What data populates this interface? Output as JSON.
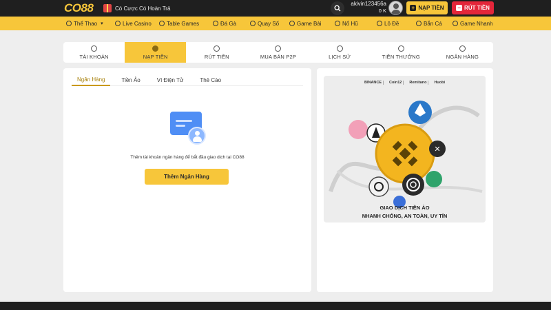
{
  "header": {
    "logo": "CO88",
    "promo_text": "Có Cược Có Hoàn Trả",
    "username": "akivin123456a",
    "balance": "0 K",
    "deposit_label": "NẠP TIỀN",
    "withdraw_label": "RÚT TIỀN"
  },
  "nav": {
    "items": [
      {
        "label": "Thể Thao",
        "icon": "sports-icon"
      },
      {
        "label": "Live Casino",
        "icon": "casino-icon"
      },
      {
        "label": "Table Games",
        "icon": "table-games-icon"
      },
      {
        "label": "Đá Gà",
        "icon": "cockfight-icon"
      },
      {
        "label": "Quay Số",
        "icon": "lottery-wheel-icon"
      },
      {
        "label": "Game Bài",
        "icon": "cards-icon"
      },
      {
        "label": "Nổ Hũ",
        "icon": "slots-icon"
      },
      {
        "label": "Lô Đề",
        "icon": "lotto-icon"
      },
      {
        "label": "Bắn Cá",
        "icon": "fishing-icon"
      },
      {
        "label": "Game Nhanh",
        "icon": "quick-game-icon"
      }
    ]
  },
  "account_tabs": {
    "items": [
      {
        "label": "TÀI KHOẢN",
        "icon": "account-icon"
      },
      {
        "label": "NẠP TIỀN",
        "icon": "deposit-icon"
      },
      {
        "label": "RÚT TIỀN",
        "icon": "withdraw-icon"
      },
      {
        "label": "MUA BÁN P2P",
        "icon": "p2p-icon"
      },
      {
        "label": "LỊCH SỬ",
        "icon": "history-icon"
      },
      {
        "label": "TIỀN THƯỞNG",
        "icon": "bonus-icon"
      },
      {
        "label": "NGÂN HÀNG",
        "icon": "bank-icon"
      }
    ],
    "active_index": 1
  },
  "deposit_methods": {
    "tabs": [
      "Ngân Hàng",
      "Tiền Ảo",
      "Ví Điện Tử",
      "Thẻ Cào"
    ],
    "active_index": 0
  },
  "bank_empty": {
    "message": "Thêm tài khoản ngân hàng để bắt đầu giao dịch tại CO88",
    "button_label": "Thêm Ngân Hàng"
  },
  "banner": {
    "partners": [
      "BINANCE",
      "Coin12",
      "Remitano",
      "Huobi"
    ],
    "caption_line1": "GIAO DỊCH TIỀN ẢO",
    "caption_line2": "NHANH CHÓNG, AN TOÀN, UY TÍN"
  },
  "colors": {
    "brand_yellow": "#f7c63a",
    "dark_bg": "#1f1f1f",
    "withdraw_red": "#e3263a"
  }
}
